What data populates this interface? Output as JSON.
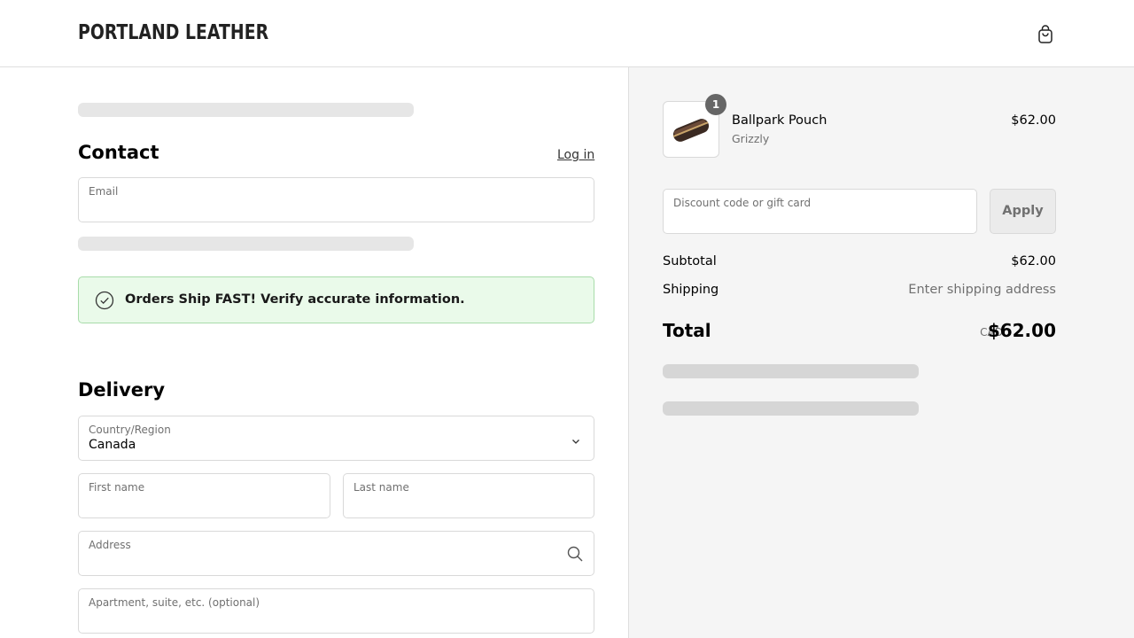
{
  "header": {
    "logo": "PORTLAND LEATHER",
    "cart_icon": "shopping-bag-icon"
  },
  "contact": {
    "title": "Contact",
    "login_link": "Log in",
    "email_label": "Email",
    "email_value": ""
  },
  "notice": {
    "icon": "check-circle-icon",
    "text": "Orders Ship FAST! Verify accurate information.",
    "color": "#eafaea"
  },
  "delivery": {
    "title": "Delivery",
    "country_label": "Country/Region",
    "country_value": "Canada",
    "first_name_label": "First name",
    "last_name_label": "Last name",
    "address_label": "Address",
    "apartment_label": "Apartment, suite, etc. (optional)"
  },
  "summary": {
    "item": {
      "quantity": "1",
      "name": "Ballpark Pouch",
      "variant": "Grizzly",
      "price": "$62.00"
    },
    "discount_placeholder": "Discount code or gift card",
    "apply_label": "Apply",
    "subtotal_label": "Subtotal",
    "subtotal_value": "$62.00",
    "shipping_label": "Shipping",
    "shipping_value": "Enter shipping address",
    "total_label": "Total",
    "total_currency": "CAD",
    "total_value": "$62.00"
  }
}
